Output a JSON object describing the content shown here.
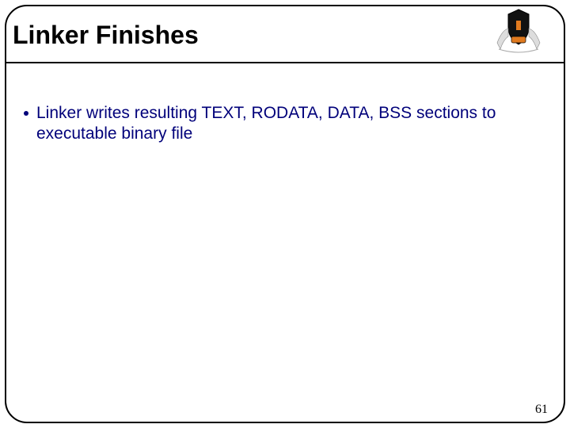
{
  "slide": {
    "title": "Linker Finishes",
    "bullets": [
      "Linker writes resulting TEXT, RODATA, DATA, BSS sections to executable binary file"
    ],
    "page_number": "61"
  }
}
